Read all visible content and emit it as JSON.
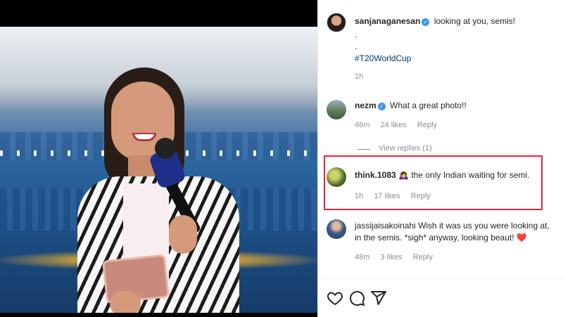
{
  "post": {
    "author": "sanjanaganesan",
    "caption_text": "looking at you, semis!",
    "caption_dot1": ".",
    "caption_dot2": ".",
    "hashtag": "#T20WorldCup",
    "time": "1h"
  },
  "comments": [
    {
      "user": "nezm",
      "verified": true,
      "text": "What a great photo!!",
      "time": "46m",
      "likes": "24 likes",
      "reply": "Reply",
      "view_replies": "View replies (1)"
    },
    {
      "user": "think.1083",
      "verified": false,
      "emoji": "🙇‍♀️",
      "text": "the only Indian waiting for semi.",
      "time": "1h",
      "likes": "17 likes",
      "reply": "Reply",
      "highlighted": true
    },
    {
      "user": "jassijaisakoinahi",
      "verified": false,
      "text": "Wish it was us you were looking at, in the semis. *sigh* anyway, looking beaut!",
      "emoji": "❤️",
      "time": "48m",
      "likes": "3 likes",
      "reply": "Reply"
    }
  ],
  "actions": [
    "heart-icon",
    "comment-icon",
    "share-icon"
  ],
  "colors": {
    "highlight_box": "#e5243b",
    "verified": "#3897f0",
    "hashtag": "#00376b",
    "muted": "#8e8e8e"
  }
}
